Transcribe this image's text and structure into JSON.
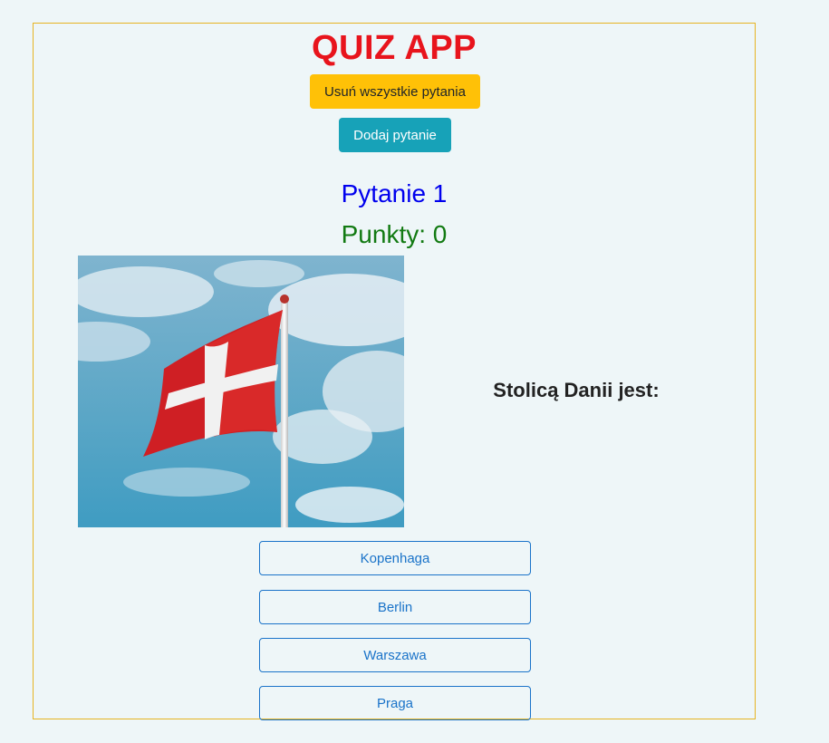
{
  "app": {
    "title": "QUIZ APP"
  },
  "controls": {
    "delete_all_label": "Usuń wszystkie pytania",
    "add_question_label": "Dodaj pytanie",
    "delete_color": "#ffc107",
    "add_color": "#17a2b8"
  },
  "quiz": {
    "question_number": "Pytanie 1",
    "points": "Punkty: 0",
    "question": "Stolicą Danii jest:",
    "image_icon": "danish-flag-on-pole-photo",
    "answers": [
      {
        "label": "Kopenhaga"
      },
      {
        "label": "Berlin"
      },
      {
        "label": "Warszawa"
      },
      {
        "label": "Praga"
      }
    ]
  },
  "colors": {
    "title": "#e8141c",
    "question_number": "#0000ee",
    "points": "#127a12",
    "answer_border": "#1a73c9",
    "frame_border": "#e6b422"
  }
}
